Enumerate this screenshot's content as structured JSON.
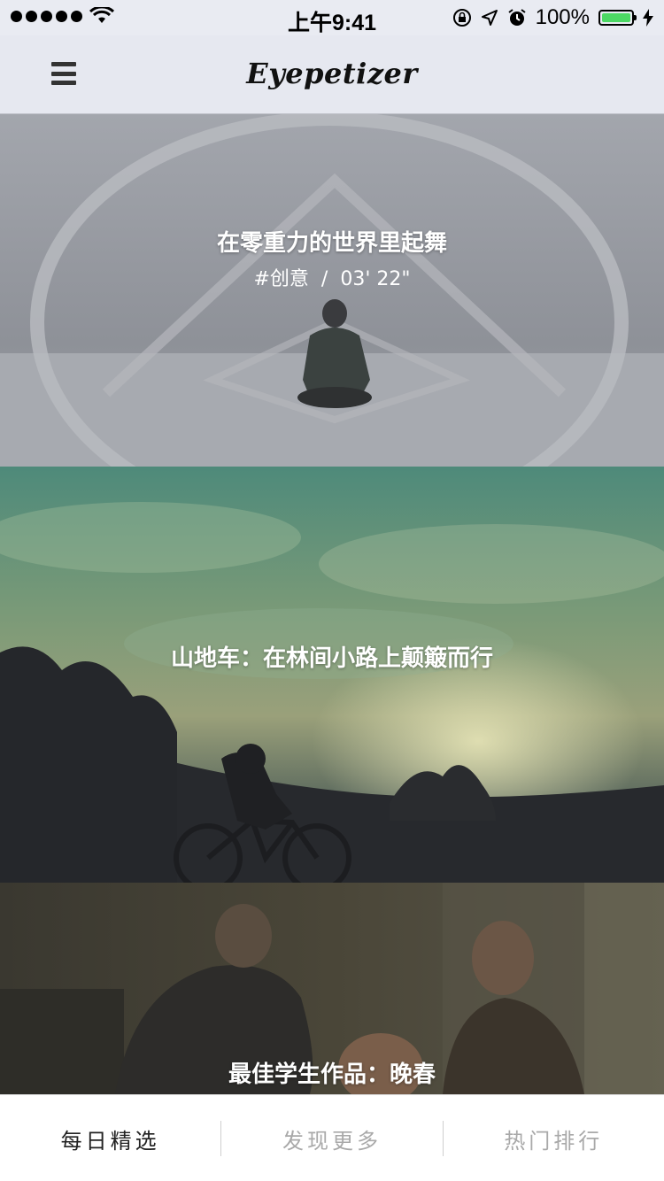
{
  "status_bar": {
    "time": "上午9:41",
    "battery": "100%",
    "battery_level": 1.0
  },
  "nav": {
    "title": "Eyepetizer",
    "menu_icon": "hamburger-menu-icon"
  },
  "feed": [
    {
      "title": "在零重力的世界里起舞",
      "category": "#创意",
      "separator": "/",
      "duration": "03' 22\""
    },
    {
      "title": "山地车：在林间小路上颠簸而行"
    },
    {
      "title": "最佳学生作品：晚春"
    }
  ],
  "tabs": [
    {
      "label": "每日精选",
      "active": true
    },
    {
      "label": "发现更多",
      "active": false
    },
    {
      "label": "热门排行",
      "active": false
    }
  ],
  "colors": {
    "battery_green": "#4cd964",
    "active_tab": "#222222",
    "inactive_tab": "#a9a9a9"
  }
}
